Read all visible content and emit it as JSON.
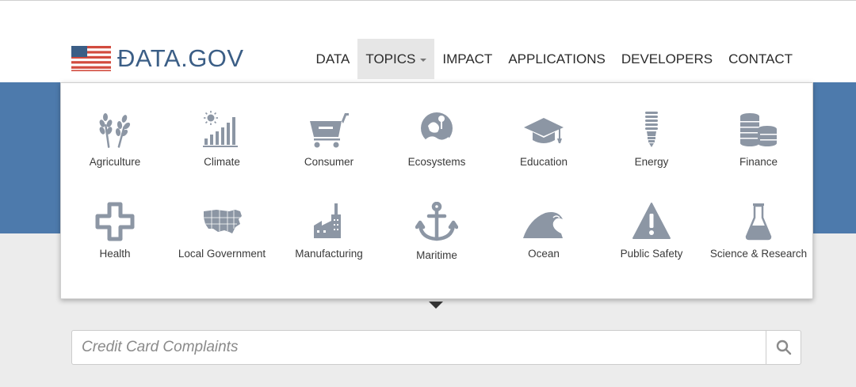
{
  "brand": {
    "logo_text": "ĐATA.GOV"
  },
  "nav": {
    "items": [
      {
        "label": "DATA"
      },
      {
        "label": "TOPICS",
        "active": true
      },
      {
        "label": "IMPACT"
      },
      {
        "label": "APPLICATIONS"
      },
      {
        "label": "DEVELOPERS"
      },
      {
        "label": "CONTACT"
      }
    ]
  },
  "topics": [
    {
      "label": "Agriculture",
      "icon": "wheat-icon"
    },
    {
      "label": "Climate",
      "icon": "climate-icon"
    },
    {
      "label": "Consumer",
      "icon": "shopping-cart-icon"
    },
    {
      "label": "Ecosystems",
      "icon": "ecosystems-icon"
    },
    {
      "label": "Education",
      "icon": "graduation-cap-icon"
    },
    {
      "label": "Energy",
      "icon": "lightbulb-icon"
    },
    {
      "label": "Finance",
      "icon": "coins-icon"
    },
    {
      "label": "Health",
      "icon": "medical-cross-icon"
    },
    {
      "label": "Local Government",
      "icon": "us-map-icon"
    },
    {
      "label": "Manufacturing",
      "icon": "factory-icon"
    },
    {
      "label": "Maritime",
      "icon": "anchor-icon"
    },
    {
      "label": "Ocean",
      "icon": "wave-icon"
    },
    {
      "label": "Public Safety",
      "icon": "warning-icon"
    },
    {
      "label": "Science & Research",
      "icon": "flask-icon"
    }
  ],
  "search": {
    "placeholder": "Credit Card Complaints"
  },
  "colors": {
    "brand_blue": "#3b5e86",
    "band_blue": "#4d7aac",
    "icon_gray": "#8c96a4"
  }
}
